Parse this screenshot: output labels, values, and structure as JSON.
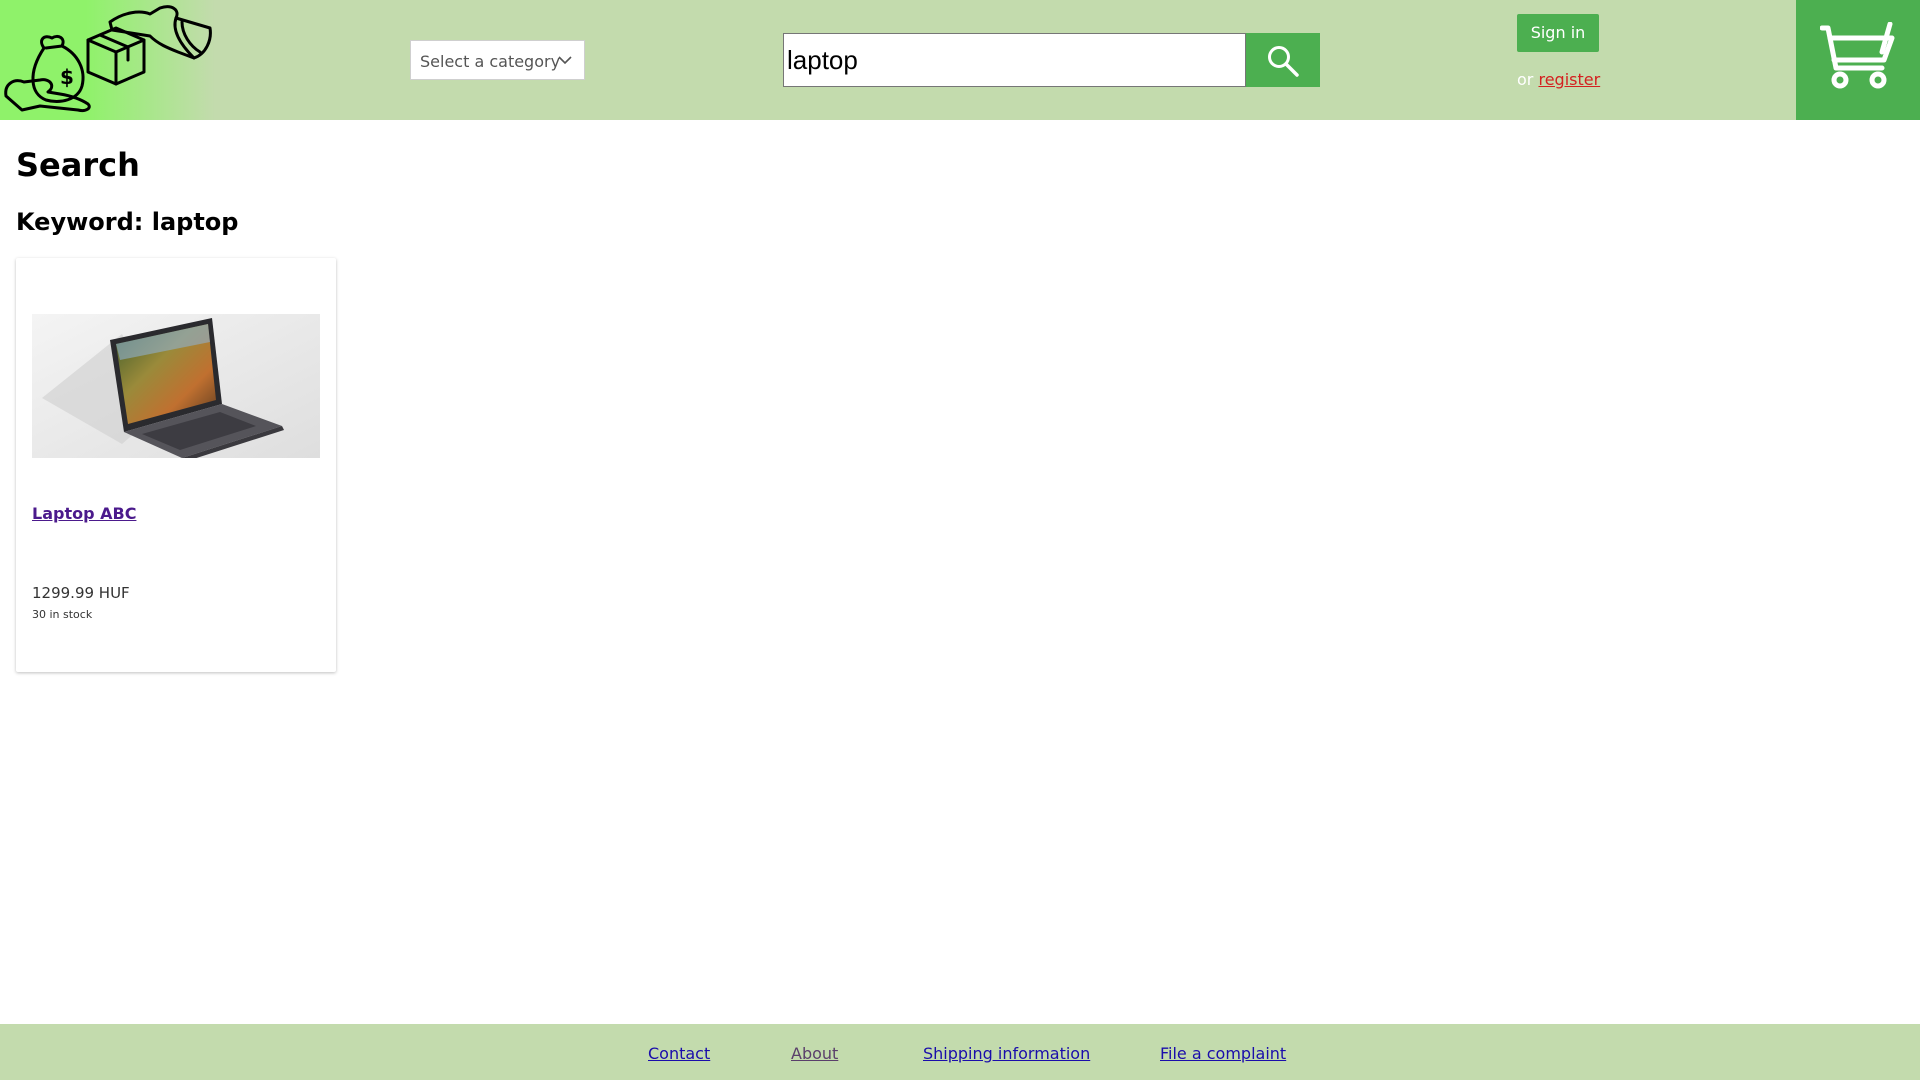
{
  "header": {
    "logo_icon": "money-bag-box-hands-logo",
    "category_select": {
      "selected": "Select a category"
    },
    "search": {
      "value": "laptop",
      "button_icon": "search-icon"
    },
    "auth": {
      "signin_label": "Sign in",
      "or_text": "or",
      "register_label": "register"
    },
    "cart_icon": "shopping-cart-icon",
    "colors": {
      "header_bg": "#c3dbad",
      "accent": "#4caf50",
      "register_link": "#d42020"
    }
  },
  "main": {
    "title": "Search",
    "keyword_line": "Keyword: laptop",
    "results": [
      {
        "name": "Laptop ABC",
        "price": "1299.99 HUF",
        "stock": "30 in stock",
        "image": "laptop-photo"
      }
    ]
  },
  "footer": {
    "links": [
      {
        "label": "Contact"
      },
      {
        "label": "About"
      },
      {
        "label": "Shipping information"
      },
      {
        "label": "File a complaint"
      }
    ]
  }
}
